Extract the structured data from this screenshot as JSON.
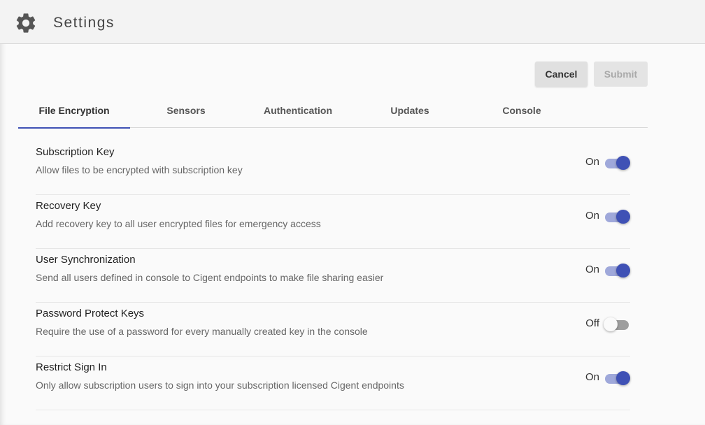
{
  "header": {
    "title": "Settings",
    "icon": "gear-icon"
  },
  "actions": {
    "cancel_label": "Cancel",
    "submit_label": "Submit"
  },
  "tabs": [
    {
      "label": "File Encryption",
      "active": true
    },
    {
      "label": "Sensors",
      "active": false
    },
    {
      "label": "Authentication",
      "active": false
    },
    {
      "label": "Updates",
      "active": false
    },
    {
      "label": "Console",
      "active": false
    }
  ],
  "settings": [
    {
      "title": "Subscription Key",
      "description": "Allow files to be encrypted with subscription key",
      "state": "On"
    },
    {
      "title": "Recovery Key",
      "description": "Add recovery key to all user encrypted files for emergency access",
      "state": "On"
    },
    {
      "title": "User Synchronization",
      "description": "Send all users defined in console to Cigent endpoints to make file sharing easier",
      "state": "On"
    },
    {
      "title": "Password Protect Keys",
      "description": "Require the use of a password for every manually created key in the console",
      "state": "Off"
    },
    {
      "title": "Restrict Sign In",
      "description": "Only allow subscription users to sign into your subscription licensed Cigent endpoints",
      "state": "On"
    }
  ],
  "colors": {
    "accent": "#3f51b5",
    "accent_track": "#9fa8da",
    "off_track": "#9e9e9e"
  }
}
